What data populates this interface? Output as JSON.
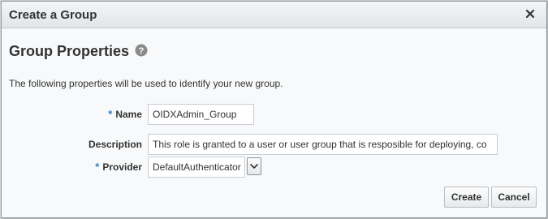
{
  "dialog": {
    "title": "Create a Group",
    "close_icon": "close-icon"
  },
  "section": {
    "title": "Group Properties",
    "help_icon": "help-icon",
    "intro": "The following properties will be used to identify your new group."
  },
  "form": {
    "required_marker": "*",
    "name_label": "Name",
    "name_value": "OIDXAdmin_Group",
    "description_label": "Description",
    "description_value": "This role is granted to a user or user group that is resposible for deploying, co",
    "provider_label": "Provider",
    "provider_value": "DefaultAuthenticator",
    "provider_dropdown_icon": "chevron-down-icon"
  },
  "buttons": {
    "create_label": "Create",
    "cancel_label": "Cancel"
  },
  "colors": {
    "required_marker": "#3a7ec4",
    "help_icon": "#8a8a8a",
    "title_text": "#333333"
  }
}
